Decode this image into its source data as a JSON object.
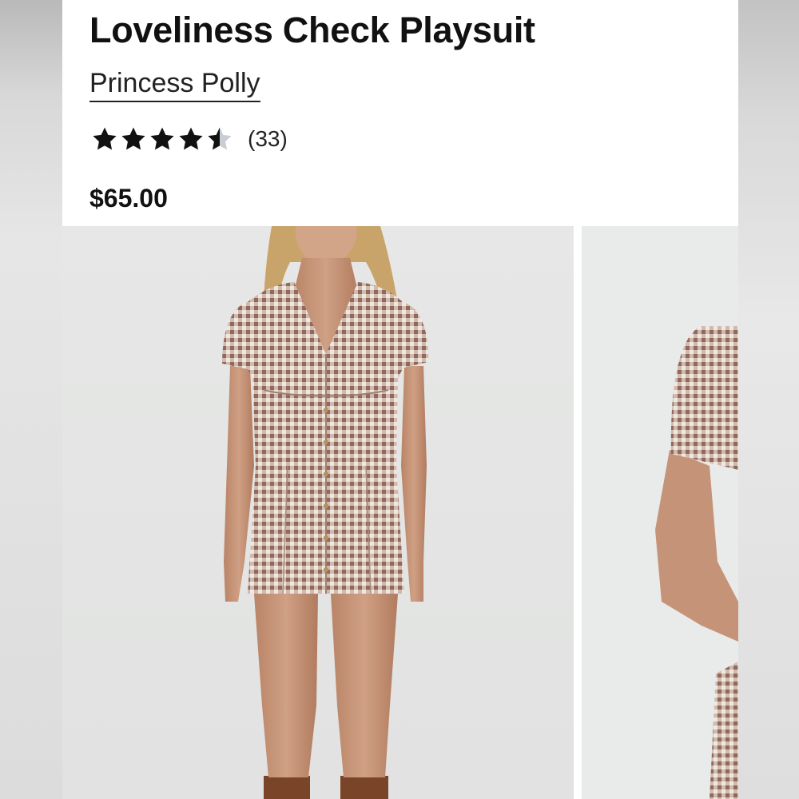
{
  "product": {
    "title": "Loveliness Check Playsuit",
    "brand": "Princess Polly",
    "rating": {
      "value": 4.5,
      "max": 5,
      "count_label": "(33)"
    },
    "price": "$65.00"
  },
  "gallery": {
    "images": [
      {
        "name": "product-photo-front",
        "alt": "Loveliness Check Playsuit front view"
      },
      {
        "name": "product-photo-side",
        "alt": "Loveliness Check Playsuit side view"
      }
    ]
  },
  "colors": {
    "text": "#111111",
    "star_filled": "#111111",
    "star_empty": "#c9ced6",
    "gingham_dark": "#9a7566",
    "gingham_light": "#efe7e1"
  }
}
